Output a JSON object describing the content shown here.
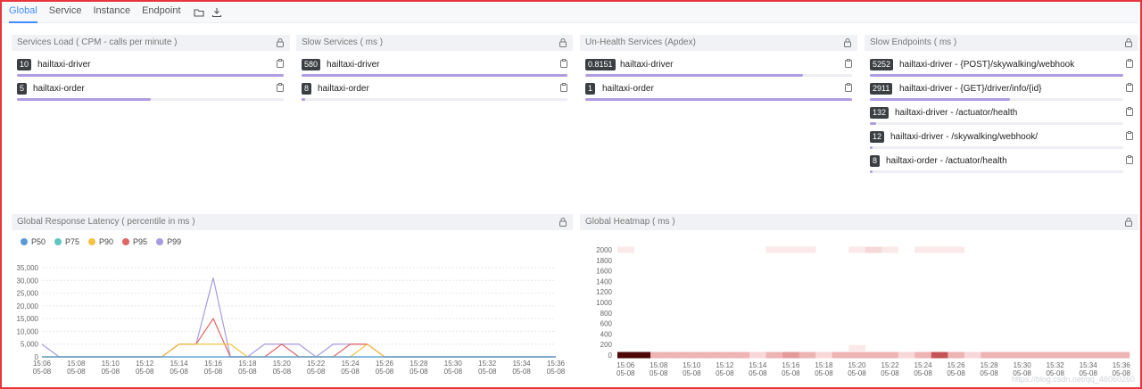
{
  "tabs": [
    {
      "label": "Global",
      "active": true
    },
    {
      "label": "Service"
    },
    {
      "label": "Instance"
    },
    {
      "label": "Endpoint"
    }
  ],
  "top_panels": [
    {
      "title": "Services Load ( CPM - calls per minute )",
      "items": [
        {
          "value": "10",
          "name": "hailtaxi-driver",
          "fill": 1.0
        },
        {
          "value": "5",
          "name": "hailtaxi-order",
          "fill": 0.5
        }
      ]
    },
    {
      "title": "Slow Services ( ms )",
      "items": [
        {
          "value": "580",
          "name": "hailtaxi-driver",
          "fill": 1.0
        },
        {
          "value": "8",
          "name": "hailtaxi-order",
          "fill": 0.014
        }
      ]
    },
    {
      "title": "Un-Health Services (Apdex)",
      "items": [
        {
          "value": "0.8151",
          "name": "hailtaxi-driver",
          "fill": 0.815
        },
        {
          "value": "1",
          "name": "hailtaxi-order",
          "fill": 1.0
        }
      ]
    },
    {
      "title": "Slow Endpoints ( ms )",
      "items": [
        {
          "value": "5252",
          "name": "hailtaxi-driver - {POST}/skywalking/webhook",
          "fill": 1.0
        },
        {
          "value": "2911",
          "name": "hailtaxi-driver - {GET}/driver/info/{id}",
          "fill": 0.554
        },
        {
          "value": "132",
          "name": "hailtaxi-driver - /actuator/health",
          "fill": 0.025
        },
        {
          "value": "12",
          "name": "hailtaxi-driver - /skywalking/webhook/",
          "fill": 0.003
        },
        {
          "value": "8",
          "name": "hailtaxi-order - /actuator/health",
          "fill": 0.002
        }
      ]
    }
  ],
  "latency": {
    "title": "Global Response Latency ( percentile in ms )",
    "chart_data": {
      "type": "line",
      "x": [
        "15:06",
        "15:07",
        "15:08",
        "15:09",
        "15:10",
        "15:11",
        "15:12",
        "15:13",
        "15:14",
        "15:15",
        "15:16",
        "15:17",
        "15:18",
        "15:19",
        "15:20",
        "15:21",
        "15:22",
        "15:23",
        "15:24",
        "15:25",
        "15:26",
        "15:27",
        "15:28",
        "15:29",
        "15:30",
        "15:31",
        "15:32",
        "15:33",
        "15:34",
        "15:35",
        "15:36"
      ],
      "x_ticks": [
        "15:06",
        "15:08",
        "15:10",
        "15:12",
        "15:14",
        "15:16",
        "15:18",
        "15:20",
        "15:22",
        "15:24",
        "15:26",
        "15:28",
        "15:30",
        "15:32",
        "15:34",
        "15:36"
      ],
      "x_date": "05-08",
      "ylim": [
        0,
        35000
      ],
      "y_ticks": [
        "0",
        "5,000",
        "10,000",
        "15,000",
        "20,000",
        "25,000",
        "30,000",
        "35,000"
      ],
      "series": [
        {
          "name": "P50",
          "color": "#5b9bd5",
          "values": [
            0,
            0,
            0,
            0,
            0,
            0,
            0,
            0,
            0,
            0,
            0,
            0,
            0,
            0,
            0,
            0,
            0,
            0,
            0,
            0,
            0,
            0,
            0,
            0,
            0,
            0,
            0,
            0,
            0,
            0,
            0
          ]
        },
        {
          "name": "P75",
          "color": "#5ec8c0",
          "values": [
            0,
            0,
            0,
            0,
            0,
            0,
            0,
            0,
            0,
            0,
            0,
            0,
            0,
            0,
            0,
            0,
            0,
            0,
            0,
            0,
            0,
            0,
            0,
            0,
            0,
            0,
            0,
            0,
            0,
            0,
            0
          ]
        },
        {
          "name": "P90",
          "color": "#f5c342",
          "values": [
            0,
            0,
            0,
            0,
            0,
            0,
            0,
            0,
            5000,
            5000,
            5000,
            5000,
            0,
            0,
            0,
            0,
            0,
            0,
            0,
            5000,
            0,
            0,
            0,
            0,
            0,
            0,
            0,
            0,
            0,
            0,
            0
          ]
        },
        {
          "name": "P95",
          "color": "#e06666",
          "values": [
            0,
            0,
            0,
            0,
            0,
            0,
            0,
            0,
            5000,
            5000,
            15000,
            0,
            0,
            0,
            5000,
            0,
            0,
            0,
            5000,
            5000,
            0,
            0,
            0,
            0,
            0,
            0,
            0,
            0,
            0,
            0,
            0
          ]
        },
        {
          "name": "P99",
          "color": "#a99be0",
          "values": [
            5000,
            0,
            0,
            0,
            0,
            0,
            0,
            0,
            5000,
            5000,
            31000,
            0,
            0,
            5000,
            5000,
            5000,
            0,
            5000,
            5000,
            5000,
            0,
            0,
            0,
            0,
            0,
            0,
            0,
            0,
            0,
            0,
            0
          ]
        }
      ]
    }
  },
  "heatmap": {
    "title": "Global Heatmap ( ms )",
    "chart_data": {
      "type": "heatmap",
      "y_ticks": [
        "0",
        "200",
        "400",
        "600",
        "800",
        "1000",
        "1200",
        "1400",
        "1600",
        "1800",
        "2000"
      ],
      "x_ticks": [
        "15:06",
        "15:08",
        "15:10",
        "15:12",
        "15:14",
        "15:16",
        "15:18",
        "15:20",
        "15:22",
        "15:24",
        "15:26",
        "15:28",
        "15:30",
        "15:32",
        "15:34",
        "15:36"
      ],
      "x_date": "05-08",
      "columns": 31,
      "row0": [
        9,
        9,
        3,
        3,
        3,
        3,
        3,
        3,
        2,
        3,
        4,
        3,
        2,
        3,
        3,
        3,
        3,
        2,
        3,
        5,
        3,
        2,
        3,
        3,
        3,
        3,
        3,
        3,
        3,
        3,
        3
      ],
      "row_top": [
        1,
        0,
        0,
        0,
        0,
        0,
        0,
        0,
        0,
        1,
        1,
        1,
        0,
        0,
        1,
        2,
        1,
        0,
        1,
        1,
        1,
        0,
        0,
        0,
        0,
        0,
        0,
        0,
        0,
        0,
        0
      ],
      "row_low": [
        0,
        0,
        0,
        0,
        0,
        0,
        0,
        0,
        0,
        0,
        0,
        0,
        0,
        0,
        1,
        0,
        0,
        0,
        0,
        0,
        0,
        0,
        0,
        0,
        0,
        0,
        0,
        0,
        0,
        0,
        0
      ]
    }
  },
  "watermark": "https://blog.csdn.net/qq_46060260"
}
